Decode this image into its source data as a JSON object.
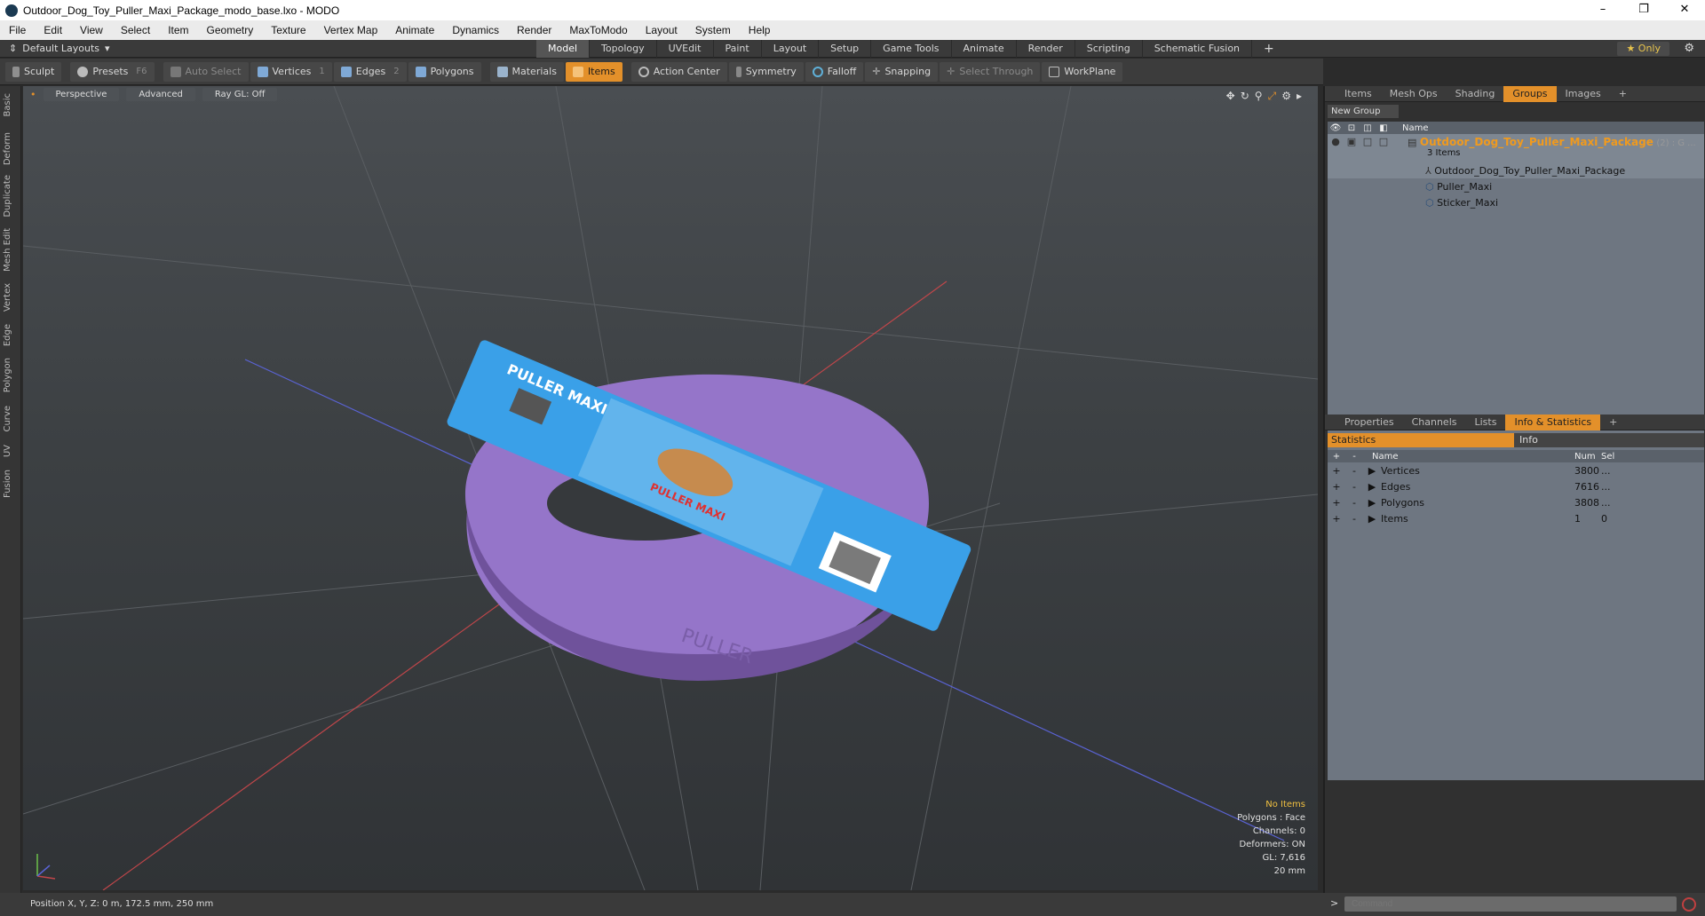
{
  "window": {
    "title": "Outdoor_Dog_Toy_Puller_Maxi_Package_modo_base.lxo - MODO",
    "minimize": "–",
    "maximize": "❐",
    "close": "✕"
  },
  "menu": [
    "File",
    "Edit",
    "View",
    "Select",
    "Item",
    "Geometry",
    "Texture",
    "Vertex Map",
    "Animate",
    "Dynamics",
    "Render",
    "MaxToModo",
    "Layout",
    "System",
    "Help"
  ],
  "layouts": {
    "label": "Default Layouts",
    "tabs": [
      "Model",
      "Topology",
      "UVEdit",
      "Paint",
      "Layout",
      "Setup",
      "Game Tools",
      "Animate",
      "Render",
      "Scripting",
      "Schematic Fusion"
    ],
    "active": "Model",
    "add": "+",
    "only": "★  Only"
  },
  "toolbar": {
    "sculpt": "Sculpt",
    "presets": "Presets",
    "presets_key": "F6",
    "auto_select": "Auto Select",
    "vertices": "Vertices",
    "vertices_key": "1",
    "edges": "Edges",
    "edges_key": "2",
    "polygons": "Polygons",
    "materials": "Materials",
    "items": "Items",
    "action_center": "Action Center",
    "symmetry": "Symmetry",
    "falloff": "Falloff",
    "snapping": "Snapping",
    "select_through": "Select Through",
    "workplane": "WorkPlane"
  },
  "left_tabs": [
    "Basic",
    "Deform",
    "Duplicate",
    "Mesh Edit",
    "Vertex",
    "Edge",
    "Polygon",
    "Curve",
    "UV",
    "Fusion"
  ],
  "viewport": {
    "view": "Perspective",
    "shading": "Advanced",
    "raygl": "Ray GL: Off",
    "hud": {
      "no_items": "No Items",
      "polygons": "Polygons : Face",
      "channels": "Channels: 0",
      "deformers": "Deformers: ON",
      "gl": "GL: 7,616",
      "scale": "20 mm"
    },
    "label_puller": "PULLER MAXI",
    "ring_text": "PULLER"
  },
  "status": {
    "position": "Position X, Y, Z:   0 m, 172.5 mm, 250 mm"
  },
  "groups_panel": {
    "tabs": [
      "Items",
      "Mesh Ops",
      "Shading",
      "Groups",
      "Images"
    ],
    "active": "Groups",
    "new_group": "New Group",
    "col_name": "Name",
    "root": {
      "name": "Outdoor_Dog_Toy_Puller_Maxi_Package",
      "suffix": "(2) : G ...",
      "count": "3 Items"
    },
    "children": [
      "Outdoor_Dog_Toy_Puller_Maxi_Package",
      "Puller_Maxi",
      "Sticker_Maxi"
    ]
  },
  "info_panel": {
    "tabs": [
      "Properties",
      "Channels",
      "Lists",
      "Info & Statistics"
    ],
    "active": "Info & Statistics",
    "sub_tabs": [
      "Statistics",
      "Info"
    ],
    "cols": {
      "name": "Name",
      "num": "Num",
      "sel": "Sel"
    },
    "rows": [
      {
        "name": "Vertices",
        "num": "3800",
        "sel": "..."
      },
      {
        "name": "Edges",
        "num": "7616",
        "sel": "..."
      },
      {
        "name": "Polygons",
        "num": "3808",
        "sel": "..."
      },
      {
        "name": "Items",
        "num": "1",
        "sel": "0"
      }
    ]
  },
  "command": {
    "placeholder": "Command",
    "prompt": ">"
  },
  "colors": {
    "accent": "#e3902a",
    "ring": "#9a7bd0",
    "label": "#3aa0e8"
  }
}
